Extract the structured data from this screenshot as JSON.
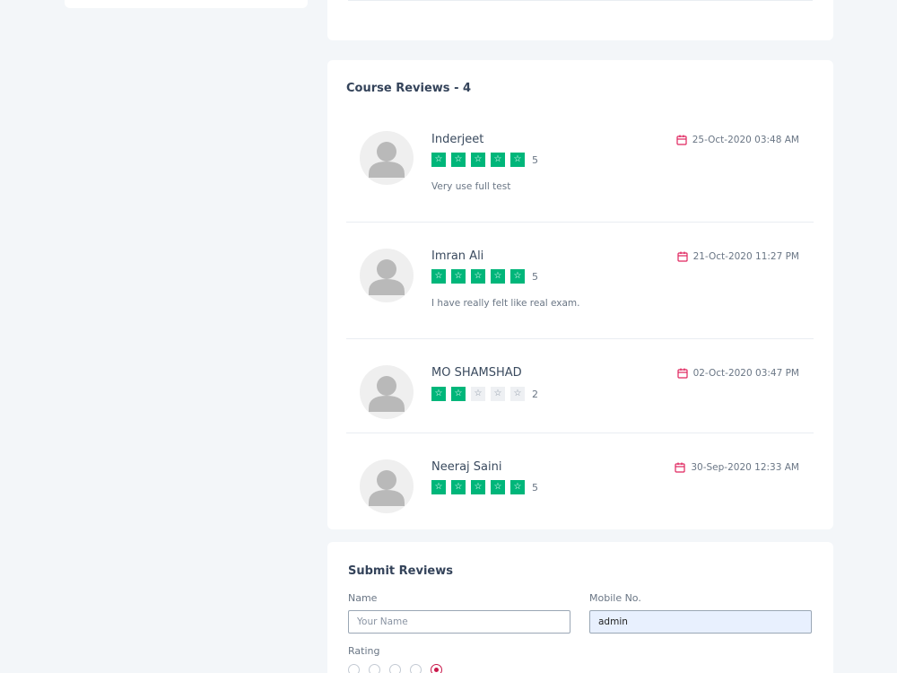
{
  "reviews_section": {
    "title": "Course Reviews - 4",
    "reviews": [
      {
        "name": "Inderjeet",
        "date": "25-Oct-2020 03:48 AM",
        "rating": 5,
        "rating_text": "5",
        "text": "Very use full test"
      },
      {
        "name": "Imran Ali",
        "date": "21-Oct-2020 11:27 PM",
        "rating": 5,
        "rating_text": "5",
        "text": "I have really felt like real exam."
      },
      {
        "name": "MO SHAMSHAD",
        "date": "02-Oct-2020 03:47 PM",
        "rating": 2,
        "rating_text": "2",
        "text": ""
      },
      {
        "name": "Neeraj Saini",
        "date": "30-Sep-2020 12:33 AM",
        "rating": 5,
        "rating_text": "5",
        "text": ""
      }
    ]
  },
  "submit_form": {
    "title": "Submit Reviews",
    "name_label": "Name",
    "name_placeholder": "Your Name",
    "name_value": "",
    "mobile_label": "Mobile No.",
    "mobile_value": "admin",
    "rating_label": "Rating",
    "rating_options": 5,
    "rating_selected": 5
  },
  "colors": {
    "star_on": "#00b67a",
    "star_off": "#eef0f3",
    "calendar_icon": "#e0245e",
    "radio_selected": "#c9184a",
    "page_bg": "#f3f6f9"
  },
  "icons": {
    "star": "star-icon",
    "calendar": "calendar-icon",
    "avatar": "user-avatar-icon"
  }
}
